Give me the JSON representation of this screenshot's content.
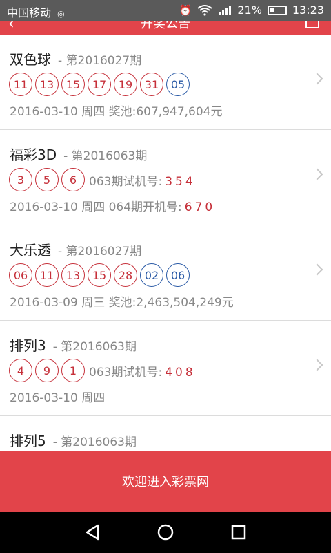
{
  "status": {
    "carrier": "中国移动",
    "battery": "21%",
    "time": "13:23"
  },
  "appbar": {
    "title": "开奖公告"
  },
  "lotteries": [
    {
      "name": "双色球",
      "issue": "- 第2016027期",
      "red_balls": [
        "11",
        "13",
        "15",
        "17",
        "19",
        "31"
      ],
      "blue_balls": [
        "05"
      ],
      "date": "2016-03-10",
      "weekday": "周四",
      "info": "奖池:607,947,604元"
    },
    {
      "name": "福彩3D",
      "issue": "- 第2016063期",
      "red_balls": [
        "3",
        "5",
        "6"
      ],
      "trial_label": "063期试机号:",
      "trial_number": "354",
      "date": "2016-03-10",
      "weekday": "周四",
      "info": "064期开机号:",
      "info_number": "670"
    },
    {
      "name": "大乐透",
      "issue": "- 第2016027期",
      "red_balls": [
        "06",
        "11",
        "13",
        "15",
        "28"
      ],
      "blue_balls": [
        "02",
        "06"
      ],
      "date": "2016-03-09",
      "weekday": "周三",
      "info": "奖池:2,463,504,249元"
    },
    {
      "name": "排列3",
      "issue": "- 第2016063期",
      "red_balls": [
        "4",
        "9",
        "1"
      ],
      "trial_label": "063期试机号:",
      "trial_number": "408",
      "date": "2016-03-10",
      "weekday": "周四"
    },
    {
      "name": "排列5",
      "issue": "- 第2016063期"
    }
  ],
  "banner": {
    "text": "欢迎进入彩票网"
  },
  "colors": {
    "accent": "#e2444a",
    "red_ball": "#c6303a",
    "blue_ball": "#2a5aa6"
  }
}
